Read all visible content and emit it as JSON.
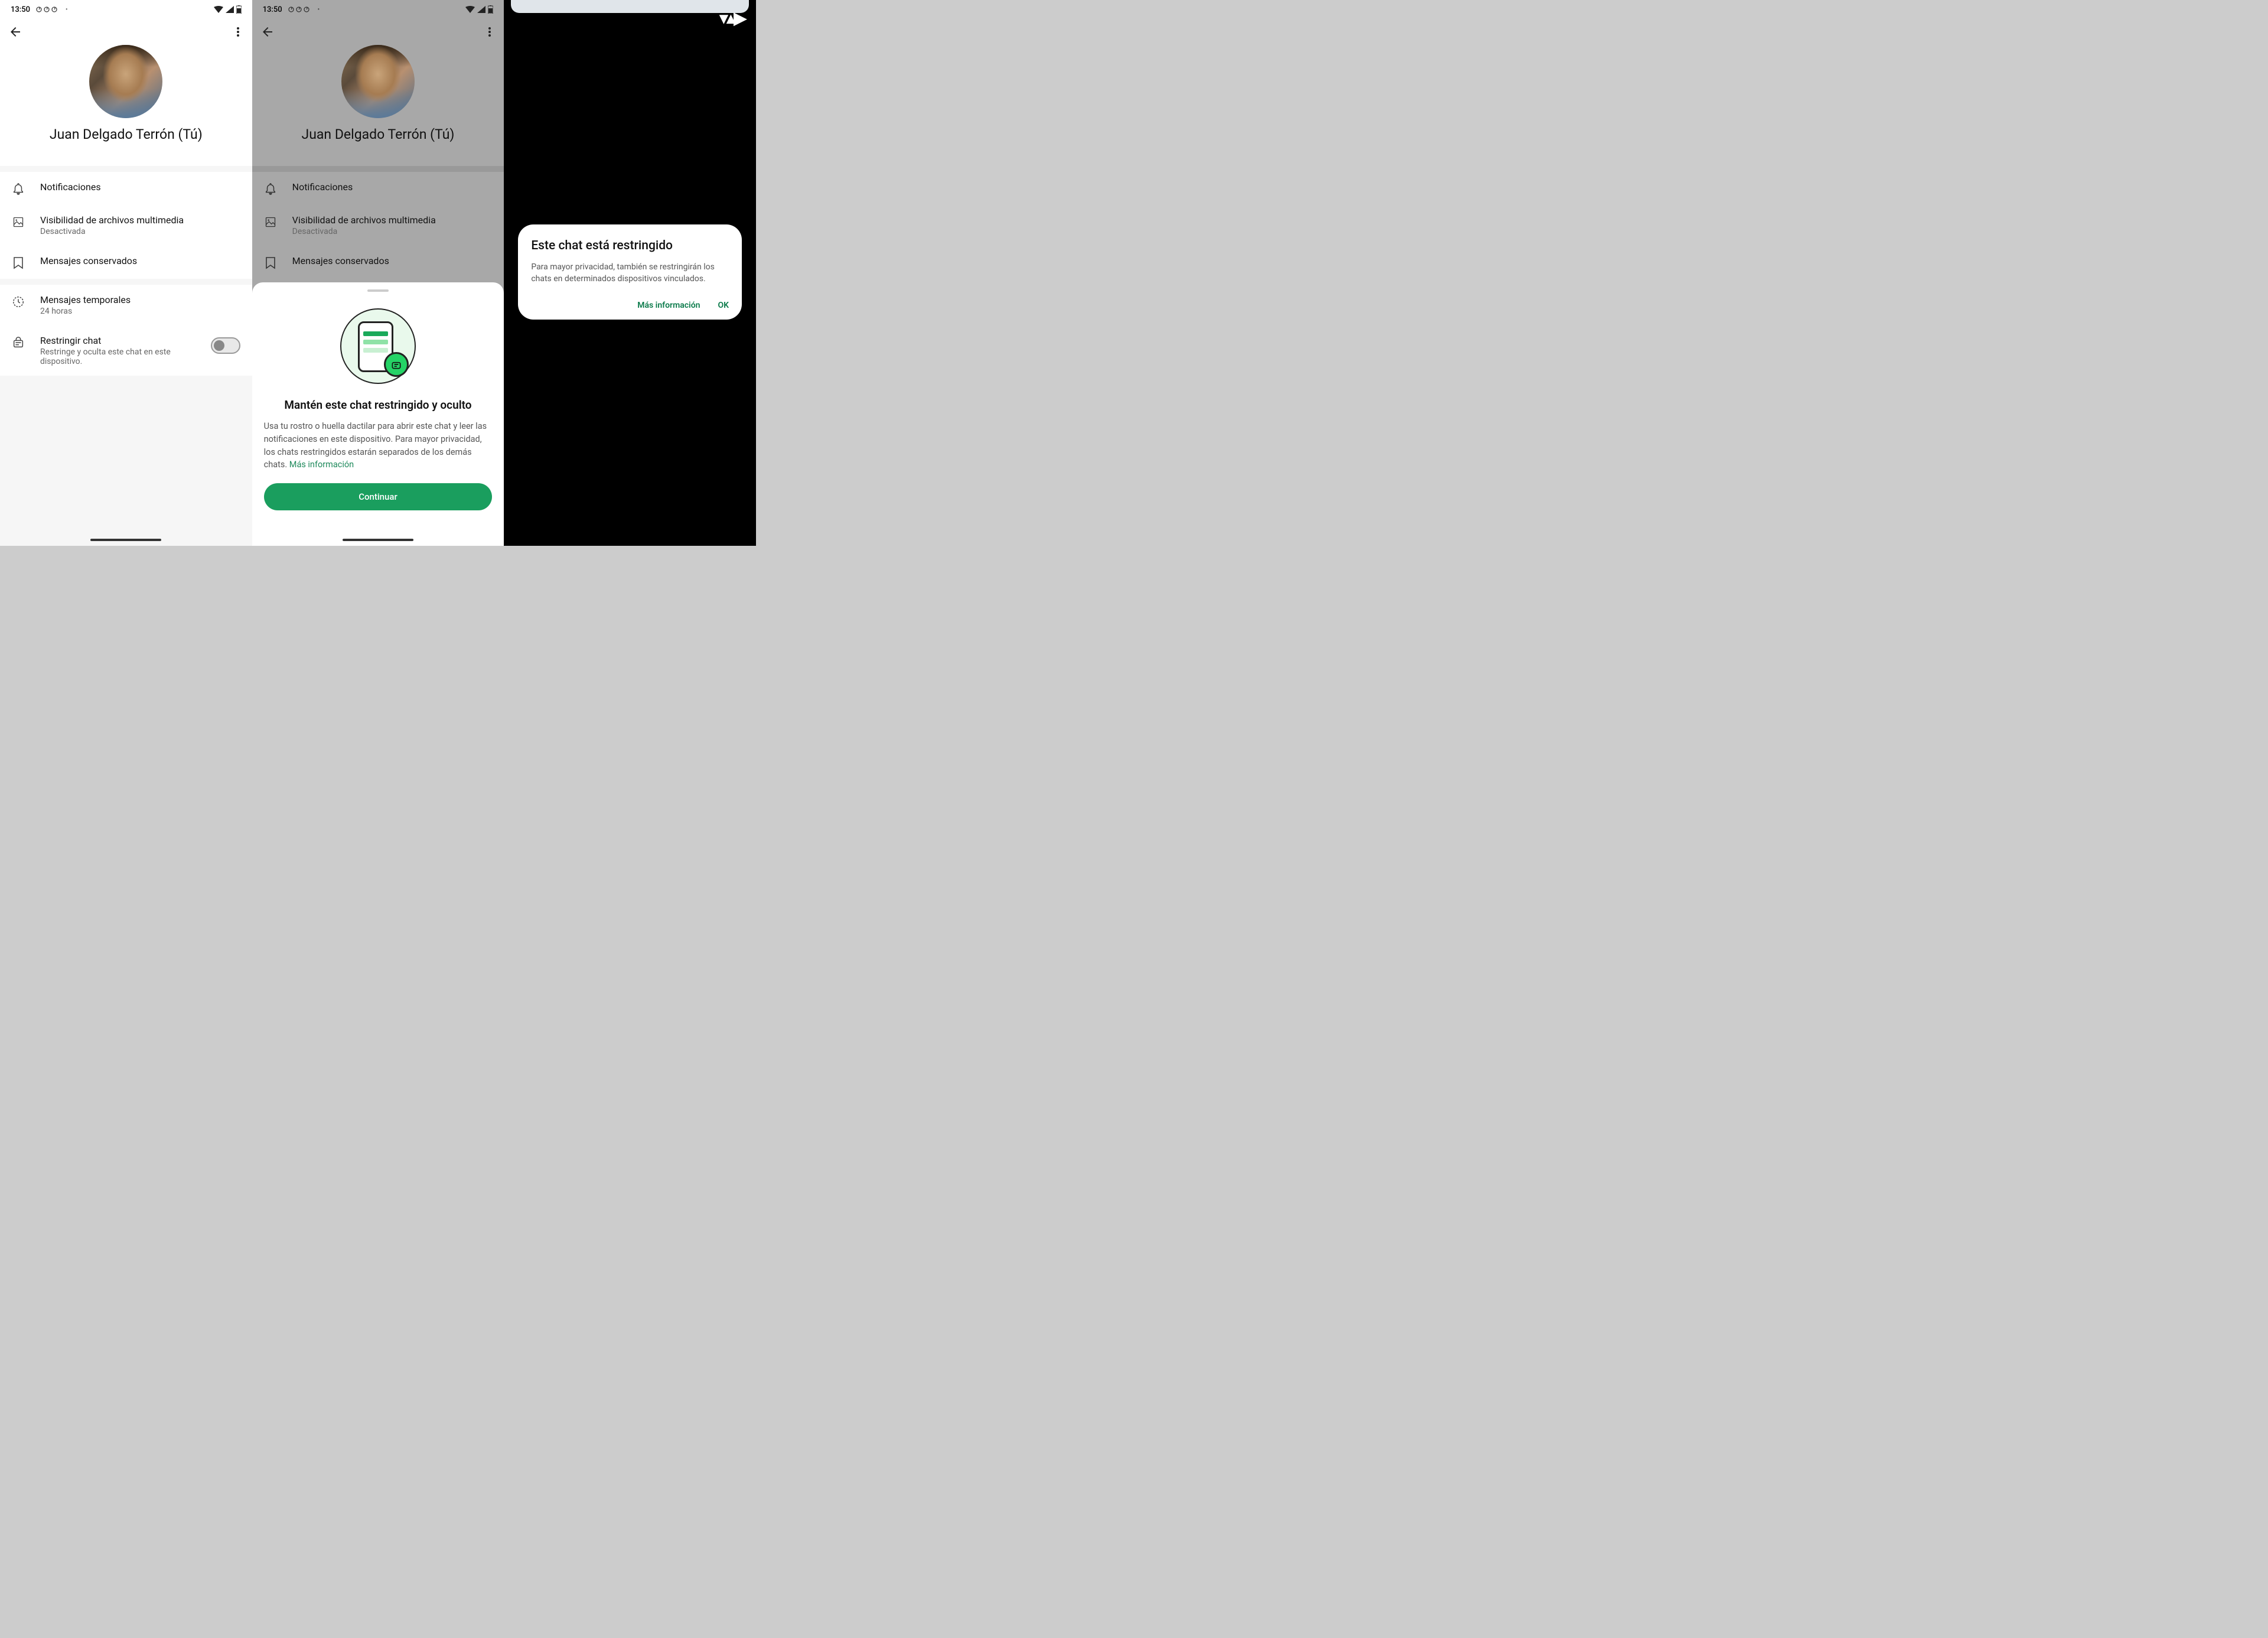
{
  "status": {
    "time": "13:50"
  },
  "profile": {
    "name": "Juan Delgado Terrón (Tú)"
  },
  "settings": {
    "notifications": {
      "title": "Notificaciones"
    },
    "media": {
      "title": "Visibilidad de archivos multimedia",
      "sub": "Desactivada"
    },
    "kept": {
      "title": "Mensajes conservados"
    },
    "temp": {
      "title": "Mensajes temporales",
      "sub": "24 horas"
    },
    "restrict": {
      "title": "Restringir chat",
      "sub": "Restringe y oculta este chat en este dispositivo."
    }
  },
  "sheet": {
    "title": "Mantén este chat restringido y oculto",
    "body": "Usa tu rostro o huella dactilar para abrir este chat y leer las notificaciones en este dispositivo. Para mayor privacidad, los chats restringidos estarán separados de los demás chats. ",
    "link": "Más información",
    "button": "Continuar"
  },
  "dialog": {
    "title": "Este chat está restringido",
    "body": "Para mayor privacidad, también se restringirán los chats en determinados dispositivos vinculados.",
    "more": "Más información",
    "ok": "OK"
  }
}
